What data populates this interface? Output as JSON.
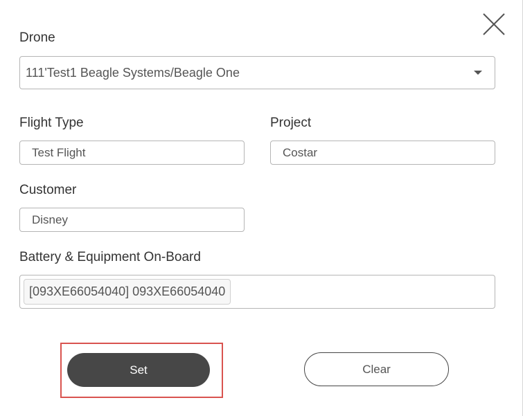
{
  "drone": {
    "label": "Drone",
    "selected": "111'Test1 Beagle Systems/Beagle One"
  },
  "flight_type": {
    "label": "Flight Type",
    "value": "Test Flight"
  },
  "project": {
    "label": "Project",
    "value": "Costar"
  },
  "customer": {
    "label": "Customer",
    "value": "Disney"
  },
  "equipment": {
    "label": "Battery & Equipment On-Board",
    "tags": [
      "[093XE66054040] 093XE66054040"
    ]
  },
  "buttons": {
    "set_label": "Set",
    "clear_label": "Clear"
  },
  "colors": {
    "primary_button": "#474747",
    "highlight": "#d9534f",
    "border": "#b5b5b5"
  }
}
